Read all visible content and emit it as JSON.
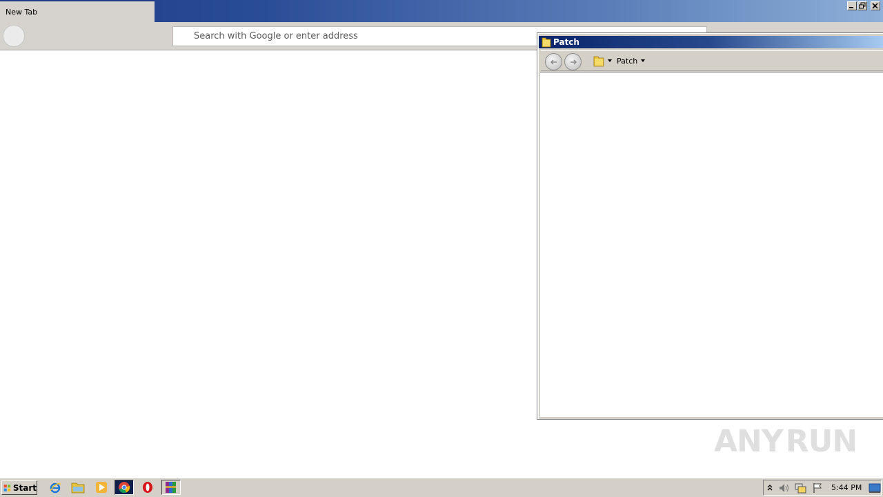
{
  "browser": {
    "tab_label": "New Tab",
    "address_placeholder": "Search with Google or enter address"
  },
  "explorer": {
    "title": "Patch",
    "breadcrumb": "Patch"
  },
  "watermark": {
    "left": "ANY",
    "right": "RUN"
  },
  "taskbar": {
    "start_label": "Start",
    "clock": "5:44 PM",
    "pinned_icons": [
      "internet-explorer-icon",
      "file-explorer-icon",
      "media-player-icon",
      "chrome-icon",
      "opera-icon",
      "winrar-icon"
    ]
  },
  "tray": {
    "icons": [
      "show-hidden-icons-icon",
      "volume-icon",
      "network-icon",
      "action-center-flag-icon",
      "show-desktop-icon"
    ]
  },
  "colors": {
    "titlebar_start": "#1c3b87",
    "titlebar_end": "#8fb0d8",
    "chrome_gray": "#d6d3ce",
    "window_face": "#d4d0c8"
  }
}
